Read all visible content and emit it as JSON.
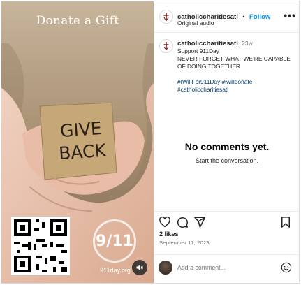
{
  "media": {
    "title": "Donate a Gift",
    "card_text_line1": "GIVE",
    "card_text_line2": "BACK",
    "badge": "9/11",
    "site": "911day.org"
  },
  "header": {
    "username": "catholiccharitiesatl",
    "separator": "•",
    "follow_label": "Follow",
    "audio_label": "Original audio",
    "more": "•••"
  },
  "caption": {
    "username": "catholiccharitiesatl",
    "age": "23w",
    "line1": "Support 911Day",
    "line2": "NEVER FORGET WHAT WE’RE CAPABLE",
    "line3": "OF DOING TOGETHER",
    "hashtags_line1": "#IWillFor911Day #iwilldonate",
    "hashtags_line2": "#catholiccharitiesatl"
  },
  "comments": {
    "empty_title": "No comments yet.",
    "empty_subtitle": "Start the conversation."
  },
  "stats": {
    "likes": "2 likes",
    "date": "September 11, 2023"
  },
  "comment_box": {
    "placeholder": "Add a comment..."
  },
  "colors": {
    "accent": "#0095f6",
    "hashtag": "#00376b"
  }
}
